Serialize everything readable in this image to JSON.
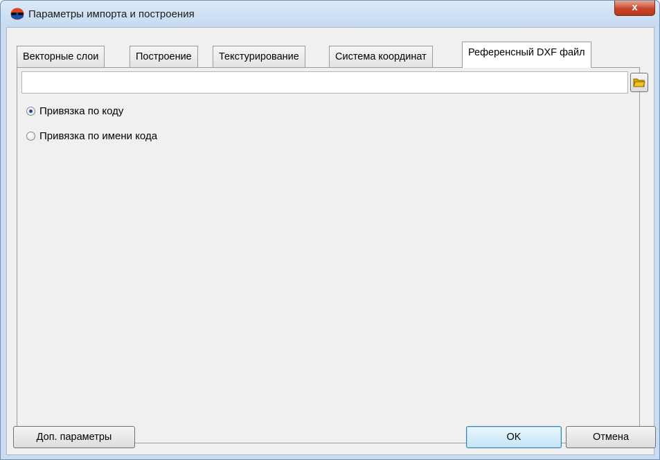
{
  "window": {
    "title": "Параметры импорта и построения",
    "close_label": "x"
  },
  "tabs": [
    {
      "label": "Векторные слои",
      "active": false
    },
    {
      "label": "Построение",
      "active": false
    },
    {
      "label": "Текстурирование",
      "active": false
    },
    {
      "label": "Система координат",
      "active": false
    },
    {
      "label": "Референсный DXF файл",
      "active": true
    }
  ],
  "dxf": {
    "path_value": "",
    "browse_icon": "folder-open-icon",
    "options": [
      {
        "label": "Привязка по коду",
        "checked": true
      },
      {
        "label": "Привязка по имени кода",
        "checked": false
      }
    ]
  },
  "buttons": {
    "advanced": "Доп. параметры",
    "ok": "OK",
    "cancel": "Отмена"
  },
  "colors": {
    "title_bar": "#c6daf0",
    "close_button": "#c7462c",
    "accent_radio": "#1f4b8e",
    "folder_icon": "#f2c318"
  }
}
